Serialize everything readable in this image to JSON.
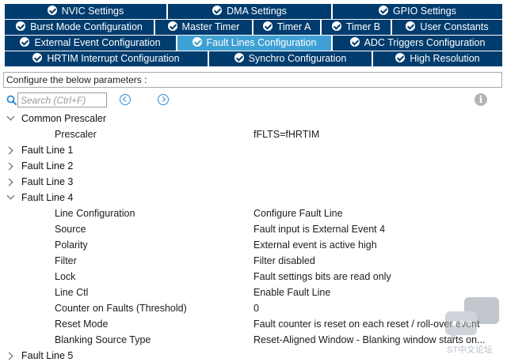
{
  "tabs": {
    "row1": [
      "NVIC Settings",
      "DMA Settings",
      "GPIO Settings"
    ],
    "row2": [
      "Burst Mode Configuration",
      "Master Timer",
      "Timer A",
      "Timer B",
      "User Constants"
    ],
    "row3": [
      "External Event Configuration",
      "Fault Lines Configuration",
      "ADC Triggers Configuration"
    ],
    "row4": [
      "HRTIM Interrupt Configuration",
      "Synchro Configuration",
      "High Resolution"
    ],
    "active": "Fault Lines Configuration",
    "colors": {
      "tab_bg": "#003c6d",
      "active_bg": "#3fa0d3",
      "text": "#ffffff"
    }
  },
  "configure_text": "Configure the below parameters :",
  "search": {
    "placeholder": "Search (Ctrl+F)"
  },
  "tree": {
    "common_prescaler": {
      "label": "Common Prescaler",
      "params": [
        {
          "label": "Prescaler",
          "value": "fFLTS=fHRTIM"
        }
      ]
    },
    "fault_line_1": "Fault Line 1",
    "fault_line_2": "Fault Line 2",
    "fault_line_3": "Fault Line 3",
    "fault_line_4": {
      "label": "Fault Line 4",
      "params": [
        {
          "label": "Line Configuration",
          "value": "Configure Fault Line"
        },
        {
          "label": "Source",
          "value": "Fault input is External Event 4"
        },
        {
          "label": "Polarity",
          "value": "External event is active high"
        },
        {
          "label": "Filter",
          "value": "Filter disabled"
        },
        {
          "label": "Lock",
          "value": "Fault settings bits are read only"
        },
        {
          "label": "Line Ctl",
          "value": "Enable Fault Line"
        },
        {
          "label": "Counter on Faults (Threshold)",
          "value": "0"
        },
        {
          "label": "Reset Mode",
          "value": "Fault counter is reset on each reset / roll-over event"
        },
        {
          "label": "Blanking Source Type",
          "value": "Reset-Aligned Window - Blanking window starts on..."
        }
      ]
    },
    "fault_line_5": "Fault Line 5"
  },
  "watermark": {
    "text": "ST中文论坛"
  }
}
